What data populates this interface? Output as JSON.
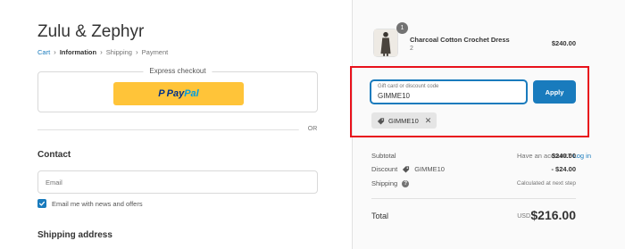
{
  "store": {
    "name": "Zulu & Zephyr"
  },
  "breadcrumb": {
    "items": [
      {
        "label": "Cart",
        "state": "link"
      },
      {
        "label": "Information",
        "state": "current"
      },
      {
        "label": "Shipping",
        "state": "upcoming"
      },
      {
        "label": "Payment",
        "state": "upcoming"
      }
    ],
    "separator_icon": "chevron-right-icon"
  },
  "express_checkout": {
    "title": "Express checkout",
    "paypal": {
      "label_pay": "Pay",
      "label_pal": "Pal",
      "mark": "P",
      "color_bg": "#ffc439",
      "color_dark": "#003087",
      "color_light": "#009cde"
    }
  },
  "divider": {
    "or_label": "OR"
  },
  "contact": {
    "title": "Contact",
    "have_account": "Have an account?",
    "login_label": "Log in",
    "email_placeholder": "Email",
    "email_value": "",
    "newsletter_label": "Email me with news and offers",
    "newsletter_checked": true
  },
  "shipping": {
    "title": "Shipping address"
  },
  "order": {
    "product": {
      "name": "Charcoal Cotton Crochet Dress",
      "variant": "2",
      "quantity": "1",
      "price": "$240.00"
    },
    "discount_form": {
      "label": "Gift card or discount code",
      "value": "GIMME10",
      "apply_label": "Apply"
    },
    "applied_code": {
      "code": "GIMME10",
      "icon": "tag-icon",
      "remove_icon": "close-icon"
    },
    "summary": {
      "subtotal_label": "Subtotal",
      "subtotal_value": "$240.00",
      "discount_label": "Discount",
      "discount_code": "GIMME10",
      "discount_value": "- $24.00",
      "shipping_label": "Shipping",
      "shipping_value": "Calculated at next step",
      "total_label": "Total",
      "total_currency": "USD",
      "total_value": "$216.00"
    }
  },
  "colors": {
    "accent": "#197bbd",
    "highlight": "#e8111b",
    "sidebar_bg": "#fafafa"
  }
}
